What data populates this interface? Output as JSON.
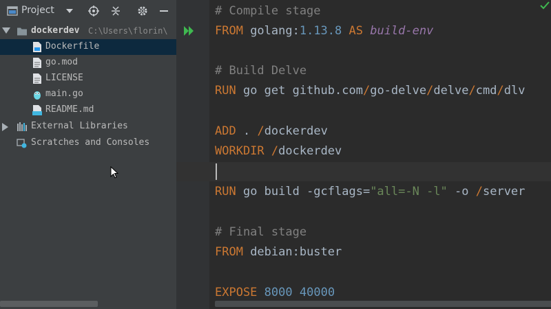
{
  "project_panel": {
    "title": "Project",
    "root": {
      "name": "dockerdev",
      "path": "C:\\Users\\florin\\"
    },
    "files": [
      {
        "name": "Dockerfile",
        "icon": "docker-file-icon",
        "selected": true
      },
      {
        "name": "go.mod",
        "icon": "text-file-icon"
      },
      {
        "name": "LICENSE",
        "icon": "text-file-icon"
      },
      {
        "name": "main.go",
        "icon": "go-gopher-icon"
      },
      {
        "name": "README.md",
        "icon": "markdown-file-icon"
      }
    ],
    "external_libraries": "External Libraries",
    "scratches": "Scratches and Consoles"
  },
  "editor": {
    "lines": [
      {
        "cm": "# Compile stage"
      },
      {
        "kw": "FROM",
        "rest": " golang:",
        "num": "1.13.8",
        "kw2": " AS ",
        "it": "build-env"
      },
      {},
      {
        "cm": "# Build Delve"
      },
      {
        "kw": "RUN",
        "rest": " go get github.com",
        "s1": "/",
        "r2": "go-delve",
        "s2": "/",
        "r3": "delve",
        "s3": "/",
        "r4": "cmd",
        "s4": "/",
        "r5": "dlv"
      },
      {},
      {
        "kw": "ADD",
        "rest": " . ",
        "s1": "/",
        "r2": "dockerdev"
      },
      {
        "kw": "WORKDIR",
        "rest": " ",
        "s1": "/",
        "r2": "dockerdev"
      },
      {},
      {
        "kw": "RUN",
        "rest": " go build -gcflags=",
        "str": "\"all=-N -l\"",
        "r2": " -o ",
        "s1": "/",
        "r3": "server"
      },
      {},
      {
        "cm": "# Final stage"
      },
      {
        "kw": "FROM",
        "rest": " debian:buster"
      },
      {},
      {
        "kw": "EXPOSE",
        "rest": " ",
        "num": "8000",
        "r2": " ",
        "num2": "40000"
      }
    ]
  },
  "colors": {
    "panel_bg": "#3c3f41",
    "editor_bg": "#2b2b2b",
    "selection": "#0d293e",
    "keyword": "#cc7832",
    "comment": "#808080",
    "number": "#6897bb",
    "string": "#6a8759",
    "run_arrow": "#3fb950"
  }
}
